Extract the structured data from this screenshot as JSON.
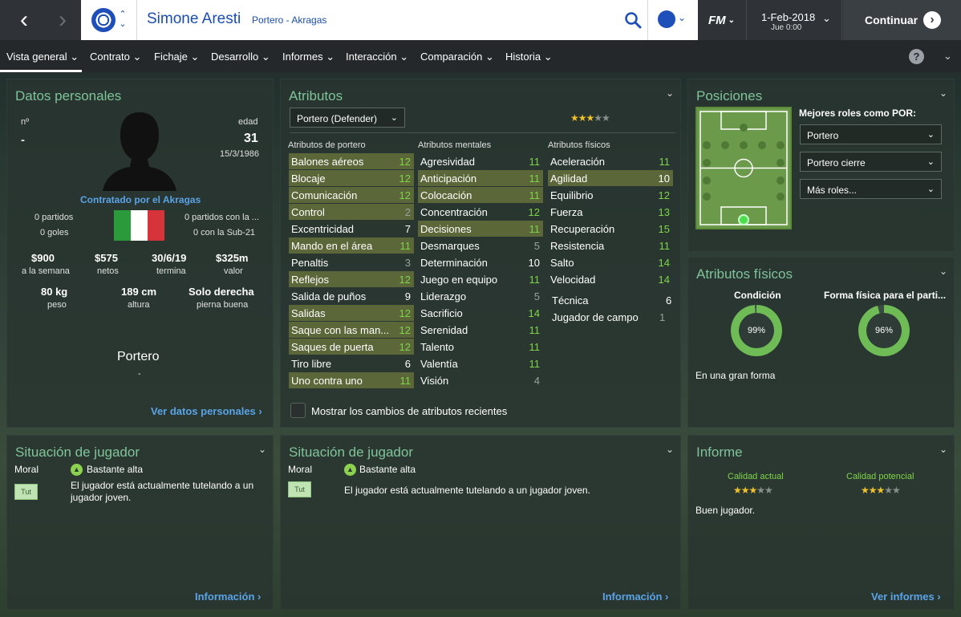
{
  "topbar": {
    "back_icon": "chevron-left-icon",
    "forward_icon": "chevron-right-icon",
    "player_name": "Simone Aresti",
    "player_subtitle": "Portero - Akragas",
    "date": "1-Feb-2018",
    "day_time": "Jue 0:00",
    "fm_label": "FM",
    "continue_label": "Continuar"
  },
  "menu": {
    "items": [
      "Vista general",
      "Contrato",
      "Fichaje",
      "Desarrollo",
      "Informes",
      "Interacción",
      "Comparación",
      "Historia"
    ],
    "help": "?"
  },
  "personal": {
    "title": "Datos personales",
    "num_label": "nº",
    "num_value": "-",
    "age_label": "edad",
    "age_value": "31",
    "birthdate": "15/3/1986",
    "contracted": "Contratado por el Akragas",
    "matches": "0 partidos",
    "goals": "0 goles",
    "matches_u21": "0 partidos con la ...",
    "goals_u21": "0 con la Sub-21",
    "wage": "$900",
    "wage_label": "a la semana",
    "net": "$575",
    "net_label": "netos",
    "expires": "30/6/19",
    "expires_label": "termina",
    "value": "$325m",
    "value_label": "valor",
    "weight": "80 kg",
    "weight_label": "peso",
    "height": "189 cm",
    "height_label": "altura",
    "foot": "Solo derecha",
    "foot_label": "pierna buena",
    "position": "Portero",
    "position_sub": "-",
    "link": "Ver datos personales"
  },
  "attributes": {
    "title": "Atributos",
    "role_selected": "Portero (Defender)",
    "role_stars": 3,
    "col1_header": "Atributos de portero",
    "col2_header": "Atributos mentales",
    "col3_header": "Atributos físicos",
    "goalkeeping": [
      {
        "name": "Balones aéreos",
        "value": "12",
        "hl": true,
        "color": "green"
      },
      {
        "name": "Blocaje",
        "value": "12",
        "hl": true,
        "color": "green"
      },
      {
        "name": "Comunicación",
        "value": "12",
        "hl": true,
        "color": "green"
      },
      {
        "name": "Control",
        "value": "2",
        "hl": true,
        "color": "grey"
      },
      {
        "name": "Excentricidad",
        "value": "7",
        "hl": false,
        "color": "white"
      },
      {
        "name": "Mando en el área",
        "value": "11",
        "hl": true,
        "color": "green"
      },
      {
        "name": "Penaltis",
        "value": "3",
        "hl": false,
        "color": "grey"
      },
      {
        "name": "Reflejos",
        "value": "12",
        "hl": true,
        "color": "green"
      },
      {
        "name": "Salida de puños",
        "value": "9",
        "hl": false,
        "color": "white"
      },
      {
        "name": "Salidas",
        "value": "12",
        "hl": true,
        "color": "green"
      },
      {
        "name": "Saque con las man...",
        "value": "12",
        "hl": true,
        "color": "green"
      },
      {
        "name": "Saques de puerta",
        "value": "12",
        "hl": true,
        "color": "green"
      },
      {
        "name": "Tiro libre",
        "value": "6",
        "hl": false,
        "color": "white"
      },
      {
        "name": "Uno contra uno",
        "value": "11",
        "hl": true,
        "color": "green"
      }
    ],
    "mental": [
      {
        "name": "Agresividad",
        "value": "11",
        "hl": false,
        "color": "green"
      },
      {
        "name": "Anticipación",
        "value": "11",
        "hl": true,
        "color": "green"
      },
      {
        "name": "Colocación",
        "value": "11",
        "hl": true,
        "color": "green"
      },
      {
        "name": "Concentración",
        "value": "12",
        "hl": false,
        "color": "green"
      },
      {
        "name": "Decisiones",
        "value": "11",
        "hl": true,
        "color": "green"
      },
      {
        "name": "Desmarques",
        "value": "5",
        "hl": false,
        "color": "grey"
      },
      {
        "name": "Determinación",
        "value": "10",
        "hl": false,
        "color": "white"
      },
      {
        "name": "Juego en equipo",
        "value": "11",
        "hl": false,
        "color": "green"
      },
      {
        "name": "Liderazgo",
        "value": "5",
        "hl": false,
        "color": "grey"
      },
      {
        "name": "Sacrificio",
        "value": "14",
        "hl": false,
        "color": "green"
      },
      {
        "name": "Serenidad",
        "value": "11",
        "hl": false,
        "color": "green"
      },
      {
        "name": "Talento",
        "value": "11",
        "hl": false,
        "color": "green"
      },
      {
        "name": "Valentía",
        "value": "11",
        "hl": false,
        "color": "green"
      },
      {
        "name": "Visión",
        "value": "4",
        "hl": false,
        "color": "grey"
      }
    ],
    "physical": [
      {
        "name": "Aceleración",
        "value": "11",
        "hl": false,
        "color": "green"
      },
      {
        "name": "Agilidad",
        "value": "10",
        "hl": true,
        "color": "white"
      },
      {
        "name": "Equilibrio",
        "value": "12",
        "hl": false,
        "color": "green"
      },
      {
        "name": "Fuerza",
        "value": "13",
        "hl": false,
        "color": "green"
      },
      {
        "name": "Recuperación",
        "value": "15",
        "hl": false,
        "color": "green"
      },
      {
        "name": "Resistencia",
        "value": "11",
        "hl": false,
        "color": "green"
      },
      {
        "name": "Salto",
        "value": "14",
        "hl": false,
        "color": "green"
      },
      {
        "name": "Velocidad",
        "value": "14",
        "hl": false,
        "color": "green"
      }
    ],
    "technique_label": "Técnica",
    "technique_value": "6",
    "outfield_label": "Jugador de campo",
    "outfield_value": "1",
    "show_changes": "Mostrar los cambios de atributos recientes"
  },
  "positions": {
    "title": "Posiciones",
    "best_roles": "Mejores roles como POR:",
    "roles": [
      "Portero",
      "Portero cierre",
      "Más roles..."
    ]
  },
  "physical_panel": {
    "title": "Atributos físicos",
    "condition_label": "Condición",
    "condition_value": "99%",
    "condition_fraction": 0.99,
    "match_fitness_label": "Forma física para el parti...",
    "match_fitness_value": "96%",
    "match_fitness_fraction": 0.96,
    "form_text": "En una gran forma"
  },
  "situation_left": {
    "title": "Situación de jugador",
    "morale_label": "Moral",
    "morale_value": "Bastante alta",
    "badge": "Tut",
    "text": "El jugador está actualmente tutelando a un jugador joven.",
    "link": "Información"
  },
  "situation_mid": {
    "title": "Situación de jugador",
    "morale_label": "Moral",
    "morale_value": "Bastante alta",
    "badge": "Tut",
    "text": "El jugador está actualmente tutelando a un jugador joven.",
    "link": "Información"
  },
  "report": {
    "title": "Informe",
    "current_label": "Calidad actual",
    "current_stars": 3,
    "potential_label": "Calidad potencial",
    "potential_stars": 3,
    "summary": "Buen jugador.",
    "link": "Ver informes"
  },
  "colors": {
    "accent_green": "#7fc49a",
    "value_green": "#7fd44a",
    "link_blue": "#5aa3e6",
    "header_blue": "#1a4db0"
  }
}
